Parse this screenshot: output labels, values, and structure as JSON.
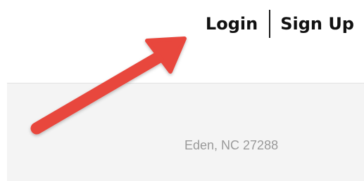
{
  "header": {
    "login_label": "Login",
    "signup_label": "Sign Up"
  },
  "content": {
    "location": "Eden, NC 27288"
  },
  "annotation": {
    "arrow_color": "#e8463e",
    "icon": "red-arrow-icon"
  }
}
